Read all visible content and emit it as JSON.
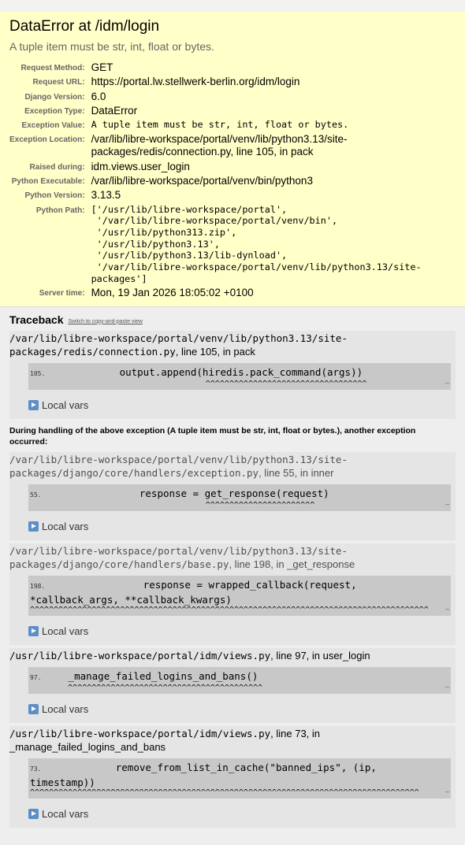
{
  "summary": {
    "title": "DataError at /idm/login",
    "message": "A tuple item must be str, int, float or bytes.",
    "meta": [
      {
        "label": "Request Method:",
        "value": "GET"
      },
      {
        "label": "Request URL:",
        "value": "https://portal.lw.stellwerk-berlin.org/idm/login"
      },
      {
        "label": "Django Version:",
        "value": "6.0"
      },
      {
        "label": "Exception Type:",
        "value": "DataError"
      },
      {
        "label": "Exception Value:",
        "value": "A tuple item must be str, int, float or bytes."
      },
      {
        "label": "Exception Location:",
        "value": "/var/lib/libre-workspace/portal/venv/lib/python3.13/site-packages/redis/connection.py, line 105, in pack"
      },
      {
        "label": "Raised during:",
        "value": "idm.views.user_login"
      },
      {
        "label": "Python Executable:",
        "value": "/var/lib/libre-workspace/portal/venv/bin/python3"
      },
      {
        "label": "Python Version:",
        "value": "3.13.5"
      },
      {
        "label": "Python Path:",
        "value": "['/usr/lib/libre-workspace/portal',\n '/var/lib/libre-workspace/portal/venv/bin',\n '/usr/lib/python313.zip',\n '/usr/lib/python3.13',\n '/usr/lib/python3.13/lib-dynload',\n '/var/lib/libre-workspace/portal/venv/lib/python3.13/site-\npackages']"
      },
      {
        "label": "Server time:",
        "value": "Mon, 19 Jan 2026 18:05:02 +0100"
      }
    ]
  },
  "traceback": {
    "heading": "Traceback",
    "switch_link": "Switch to copy-and-paste view",
    "local_vars_label": "Local vars",
    "during_text": "During handling of the above exception (A tuple item must be str, int, float or bytes.), another exception occurred:",
    "frames": [
      {
        "path": "/var/lib/libre-workspace/portal/venv/lib/python3.13/site-packages/redis/connection.py",
        "suffix": ", line 105, in pack",
        "lineno": "105.",
        "code": "            output.append(hiredis.pack_command(args))",
        "caret": "                                     ^^^^^^^^^^^^^^^^^^^^^^^^^^^^^^^^^^"
      },
      {
        "path": "/var/lib/libre-workspace/portal/venv/lib/python3.13/site-packages/django/core/handlers/exception.py",
        "suffix": ", line 55, in inner",
        "lineno": "55.",
        "code": "                response = get_response(request)",
        "caret": "                                     ^^^^^^^^^^^^^^^^^^^^^^^"
      },
      {
        "path": "/var/lib/libre-workspace/portal/venv/lib/python3.13/site-packages/django/core/handlers/base.py",
        "suffix": ", line 198, in _get_response",
        "lineno": "198.",
        "code": "                response = wrapped_callback(request, *callback_args, **callback_kwargs)",
        "caret": "^^^^^^^^^^^^^^^^^^^^^^^^^^^^^^^^^^^^^^^^^^^^^^^^^^^^^^^^^^^^^^^^^^^^^^^^^^^^^^^^^^^^"
      },
      {
        "path": "/usr/lib/libre-workspace/portal/idm/views.py",
        "suffix": ", line 97, in user_login",
        "lineno": "97.",
        "code": "    _manage_failed_logins_and_bans()",
        "caret": "        ^^^^^^^^^^^^^^^^^^^^^^^^^^^^^^^^^^^^^^^^^"
      },
      {
        "path": "/usr/lib/libre-workspace/portal/idm/views.py",
        "suffix": ", line 73, in _manage_failed_logins_and_bans",
        "lineno": "73.",
        "code": "            remove_from_list_in_cache(\"banned_ips\", (ip, timestamp))",
        "caret": "^^^^^^^^^^^^^^^^^^^^^^^^^^^^^^^^^^^^^^^^^^^^^^^^^^^^^^^^^^^^^^^^^^^^^^^^^^^^^^^^^^"
      }
    ]
  }
}
